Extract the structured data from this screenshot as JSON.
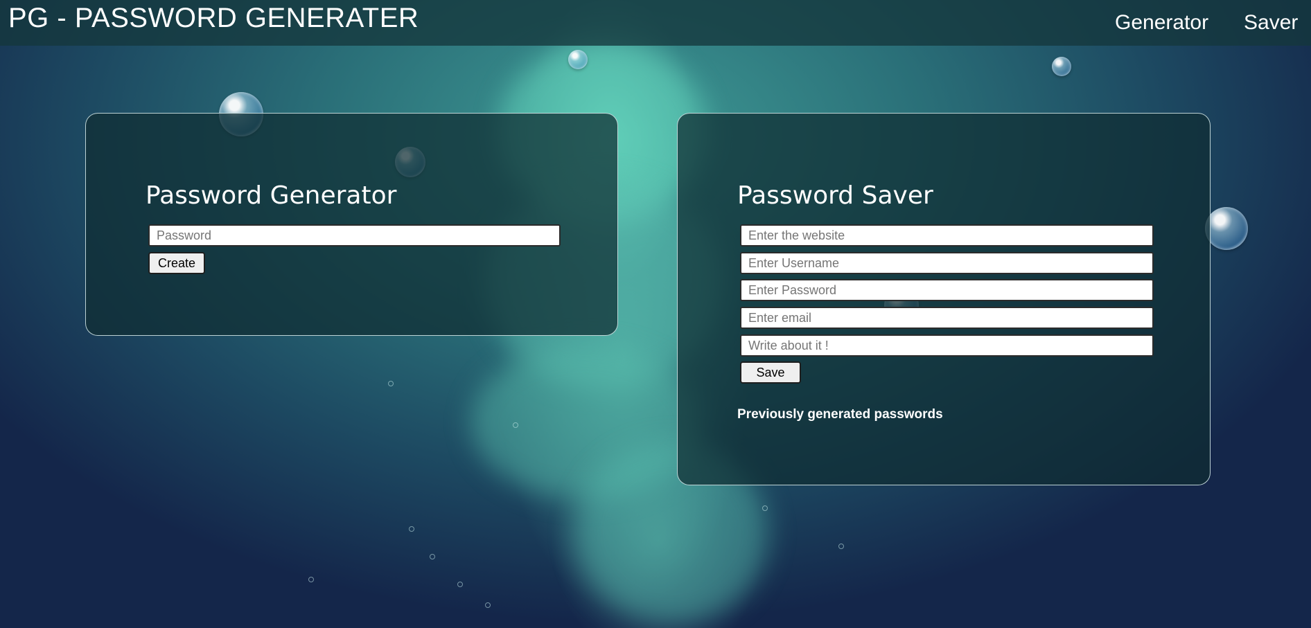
{
  "app": {
    "brand": "PG - PASSWORD GENERATER"
  },
  "nav": {
    "generator": "Generator",
    "saver": "Saver"
  },
  "generator": {
    "title": "Password Generator",
    "password_placeholder": "Password",
    "password_value": "",
    "create_label": "Create"
  },
  "saver": {
    "title": "Password Saver",
    "website_placeholder": "Enter the website",
    "username_placeholder": "Enter Username",
    "password_placeholder": "Enter Password",
    "email_placeholder": "Enter email",
    "about_placeholder": "Write about it !",
    "save_label": "Save",
    "previous_label": "Previously generated passwords"
  },
  "colors": {
    "accent": "#3f9a95",
    "panel": "#0f2d32",
    "topbar": "#14373c"
  }
}
